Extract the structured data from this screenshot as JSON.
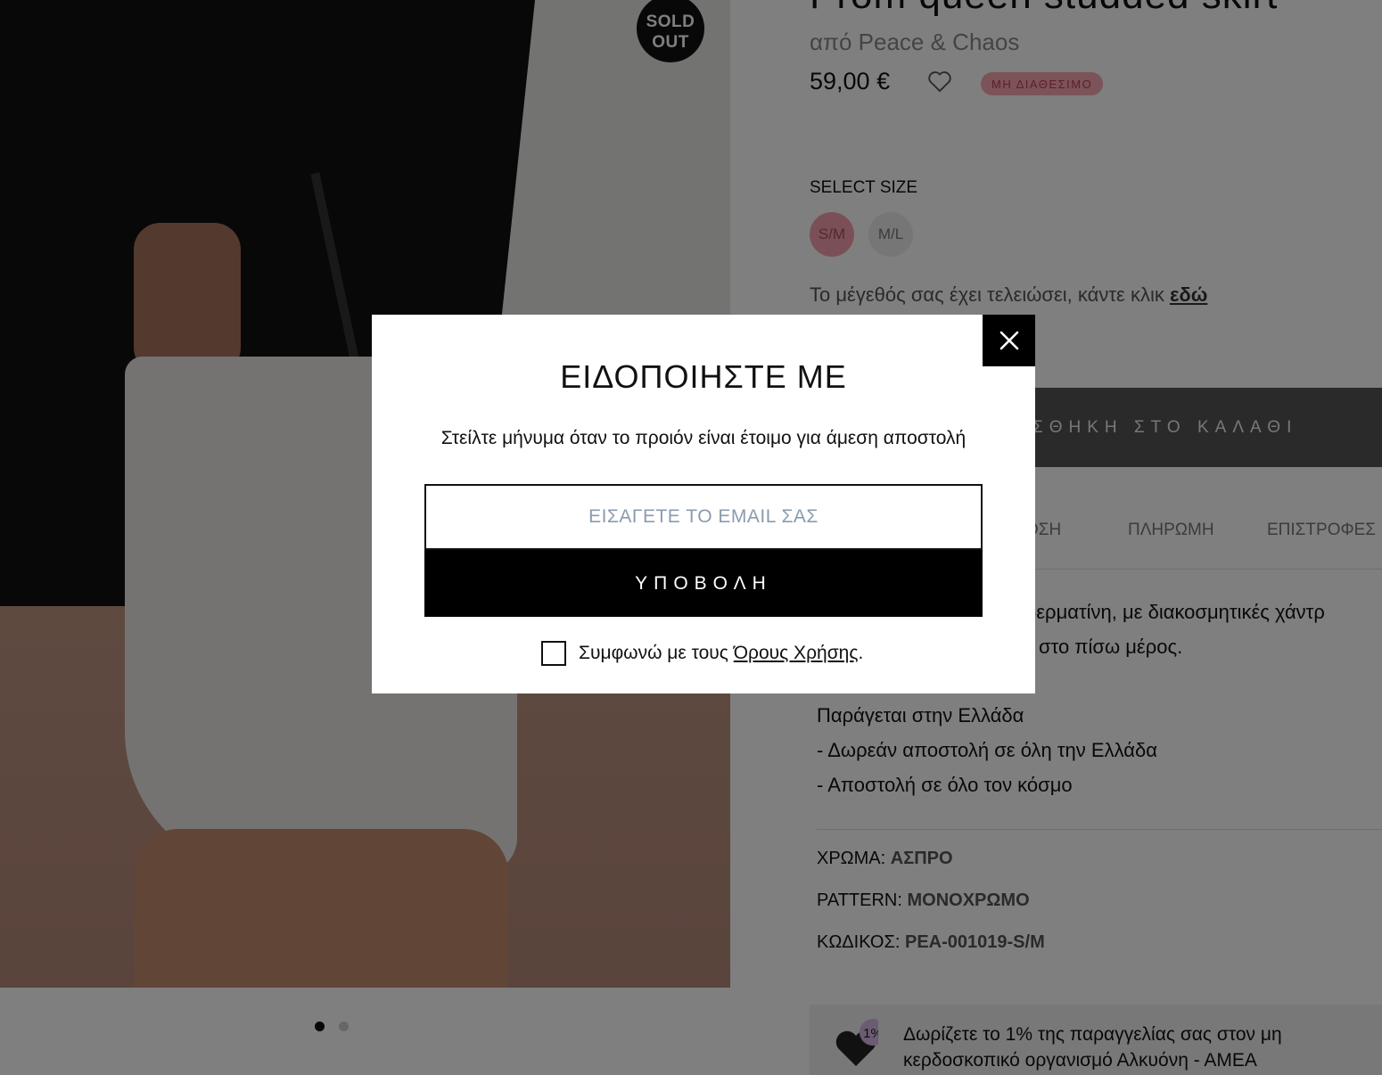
{
  "product": {
    "badge_line1": "SOLD",
    "badge_line2": "OUT",
    "title": "Prom queen studded skirt",
    "brand": "από Peace & Chaos",
    "price": "59,00 €",
    "availability": "ΜΗ ΔΙΑΘΕΣΙΜΟ",
    "select_size_label": "SELECT SIZE",
    "sizes": [
      "S/M",
      "M/L"
    ],
    "size_msg": "Το μέγεθός σας έχει τελειώσει, κάντε κλικ",
    "size_msg_link": "εδώ",
    "add_to_cart": "ΣΘΗΚΗ ΣΤΟ ΚΑΛΑΘΙ",
    "tabs": [
      "ΟΣΗ",
      "ΠΛΗΡΩΜΗ",
      "ΕΠΙΣΤΡΟΦΕΣ"
    ],
    "desc_line1": "δερματίνη, με διακοσμητικές χάντρ",
    "desc_line2": "στο πίσω μέρος.",
    "desc_line3": "Παράγεται στην Ελλάδα",
    "desc_line4": "- Δωρεάν αποστολή σε όλη την Ελλάδα",
    "desc_line5": "- Αποστολή σε όλο τον κόσμο",
    "attributes": [
      {
        "label": "ΧΡΩΜΑ:",
        "value": "ΑΣΠΡΟ"
      },
      {
        "label": "PATTERN:",
        "value": "ΜΟΝΟΧΡΩΜΟ"
      },
      {
        "label": "ΚΩΔΙΚΟΣ:",
        "value": "PEA-001019-S/M"
      }
    ],
    "donate_badge": "1%",
    "donate_line1": "Δωρίζετε το 1% της παραγγελίας σας στον μη",
    "donate_line2": "κερδοσκοπικό οργανισμό Αλκυόνη - ΑΜΕΑ"
  },
  "modal": {
    "title": "ΕΙΔΟΠΟΙΗΣΤΕ ΜΕ",
    "subtitle": "Στείλτε μήνυμα όταν το προιόν είναι έτοιμο για άμεση αποστολή",
    "email_placeholder": "ΕΙΣΑΓΕΤΕ ΤΟ EMAIL ΣΑΣ",
    "email_value": "",
    "submit_label": "ΥΠΟΒΟΛΗ",
    "terms_prefix": "Συμφωνώ με τους",
    "terms_link": "Όρους Χρήσης",
    "terms_suffix": "."
  },
  "colors": {
    "overlay": "rgba(0,0,0,0.5)",
    "accent_pink": "#f4a0ad",
    "black": "#000000"
  }
}
